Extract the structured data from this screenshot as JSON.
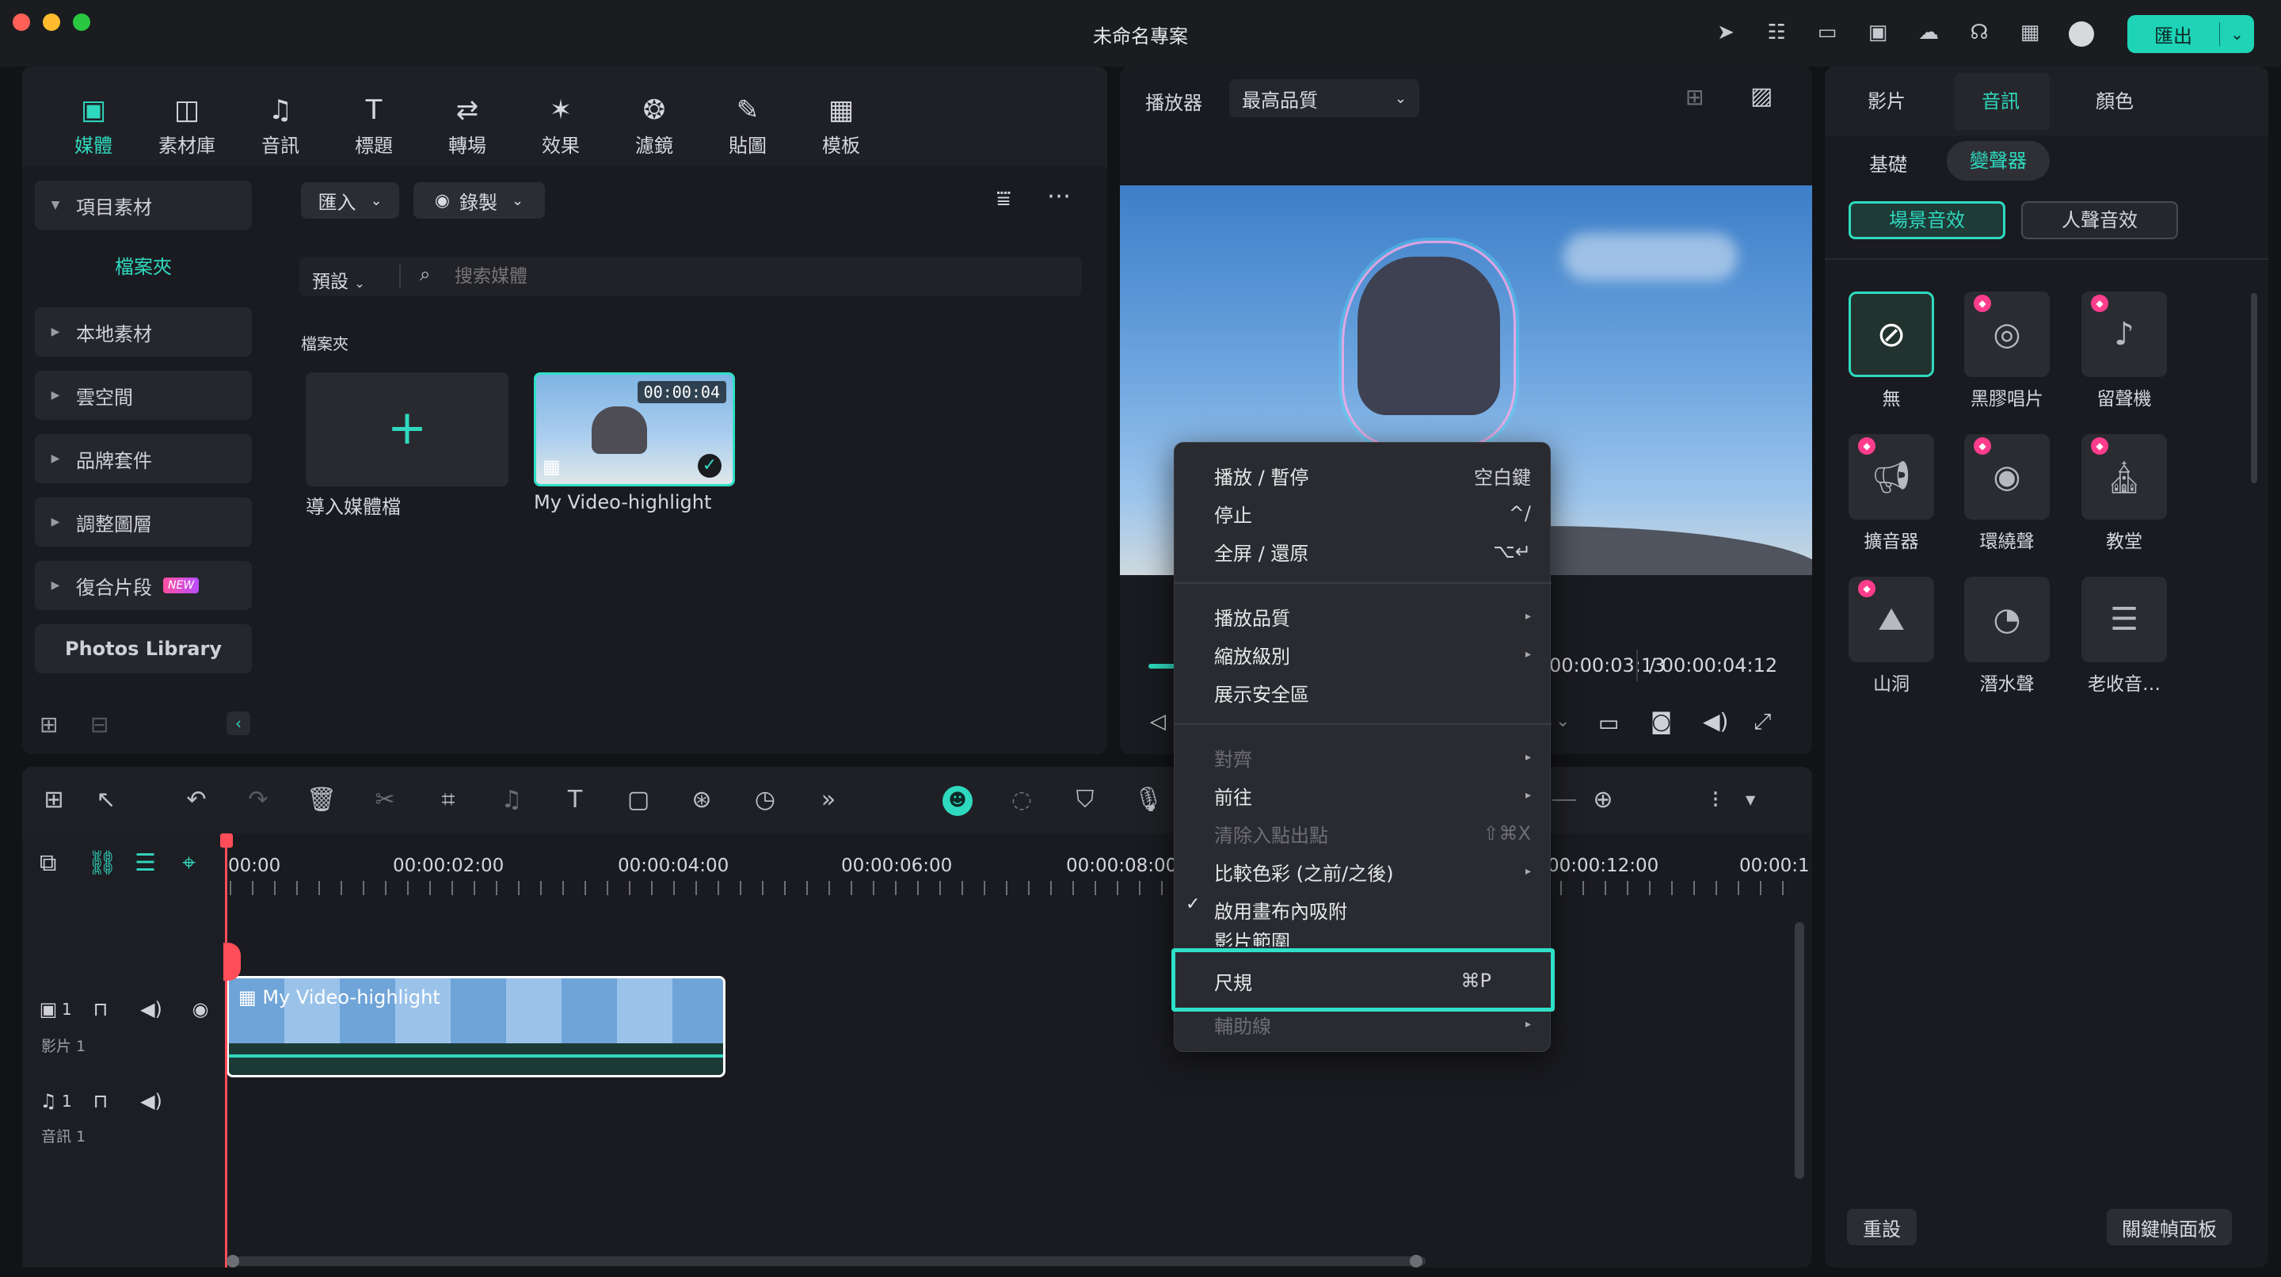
{
  "app": {
    "title": "未命名專案",
    "export_label": "匯出"
  },
  "toolbar_icons": [
    "send-icon",
    "task-icon",
    "layout-icon",
    "save-icon",
    "cloud-icon",
    "headset-icon",
    "grid-icon",
    "avatar"
  ],
  "tool_tabs": [
    {
      "label": "媒體",
      "icon": "▣"
    },
    {
      "label": "素材庫",
      "icon": "◫"
    },
    {
      "label": "音訊",
      "icon": "♫"
    },
    {
      "label": "標題",
      "icon": "T"
    },
    {
      "label": "轉場",
      "icon": "⇄"
    },
    {
      "label": "效果",
      "icon": "✶"
    },
    {
      "label": "濾鏡",
      "icon": "❂"
    },
    {
      "label": "貼圖",
      "icon": "✎"
    },
    {
      "label": "模板",
      "icon": "▦"
    }
  ],
  "sidebar": {
    "items": [
      {
        "label": "項目素材",
        "expanded": true
      },
      {
        "label": "檔案夾",
        "sub": true
      },
      {
        "label": "本地素材"
      },
      {
        "label": "雲空間"
      },
      {
        "label": "品牌套件"
      },
      {
        "label": "調整圖層"
      },
      {
        "label": "復合片段",
        "badge": "NEW"
      },
      {
        "label": "Photos Library"
      }
    ]
  },
  "media": {
    "import_label": "匯入",
    "record_label": "錄製",
    "preset_label": "預設",
    "search_placeholder": "搜索媒體",
    "folder_heading": "檔案夾",
    "import_tile_label": "導入媒體檔",
    "clip_name": "My Video-highlight",
    "clip_duration": "00:00:04"
  },
  "player": {
    "label": "播放器",
    "quality": "最高品質",
    "current_time": "00:00:03:13",
    "total_time": "/  00:00:04:12"
  },
  "context_menu": {
    "items": [
      {
        "label": "播放 / 暫停",
        "shortcut": "空白鍵"
      },
      {
        "label": "停止",
        "shortcut": "^/"
      },
      {
        "label": "全屏 / 還原",
        "shortcut": "⌥↵"
      },
      {
        "label": "播放品質",
        "submenu": true
      },
      {
        "label": "縮放級別",
        "submenu": true
      },
      {
        "label": "展示安全區"
      },
      {
        "label": "對齊",
        "submenu": true,
        "disabled": true
      },
      {
        "label": "前往",
        "submenu": true
      },
      {
        "label": "清除入點出點",
        "shortcut": "⇧⌘X",
        "disabled": true
      },
      {
        "label": "比較色彩 (之前/之後)",
        "submenu": true
      },
      {
        "label": "啟用畫布內吸附",
        "checked": true
      },
      {
        "label": "影片範圍"
      },
      {
        "label": "尺規",
        "shortcut": "⌘P",
        "highlighted": true
      },
      {
        "label": "輔助線",
        "submenu": true,
        "disabled": true
      }
    ]
  },
  "right_panel": {
    "tabs": [
      "影片",
      "音訊",
      "顏色"
    ],
    "active_tab": "音訊",
    "subtabs": [
      "基礎",
      "變聲器"
    ],
    "active_subtab": "變聲器",
    "categories": [
      "場景音效",
      "人聲音效"
    ],
    "effects": [
      {
        "label": "無",
        "premium": false
      },
      {
        "label": "黑膠唱片",
        "premium": true
      },
      {
        "label": "留聲機",
        "premium": true
      },
      {
        "label": "擴音器",
        "premium": true
      },
      {
        "label": "環繞聲",
        "premium": true
      },
      {
        "label": "教堂",
        "premium": true
      },
      {
        "label": "山洞",
        "premium": true
      },
      {
        "label": "潛水聲",
        "premium": false
      },
      {
        "label": "老收音…",
        "premium": false
      }
    ],
    "reset_label": "重設",
    "keyframe_label": "關鍵幀面板"
  },
  "timeline": {
    "ruler": [
      "00:00",
      "00:00:02:00",
      "00:00:04:00",
      "00:00:06:00",
      "00:00:08:00",
      "00:00:12:00",
      "00:00:1"
    ],
    "tracks": [
      {
        "name": "影片 1",
        "num": "1"
      },
      {
        "name": "音訊 1",
        "num": "1"
      }
    ],
    "clip_label": "My Video-highlight"
  },
  "colors": {
    "accent": "#1ed3b6",
    "playhead": "#ff4d5a",
    "highlight_box": "#2fe0c8"
  }
}
